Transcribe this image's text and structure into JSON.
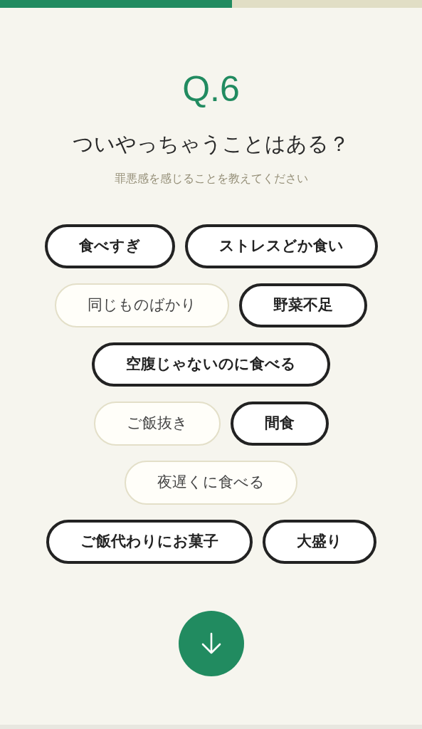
{
  "progress": {
    "level": 0.55
  },
  "question": {
    "number": "Q.6",
    "title": "ついやっちゃうことはある？",
    "subtitle": "罪悪感を感じることを教えてください"
  },
  "options": [
    {
      "label": "食べすぎ",
      "selected": true
    },
    {
      "label": "ストレスどか食い",
      "selected": true
    },
    {
      "label": "同じものばかり",
      "selected": false
    },
    {
      "label": "野菜不足",
      "selected": true
    },
    {
      "label": "空腹じゃないのに食べる",
      "selected": true
    },
    {
      "label": "ご飯抜き",
      "selected": false
    },
    {
      "label": "間食",
      "selected": true
    },
    {
      "label": "夜遅くに食べる",
      "selected": false
    },
    {
      "label": "ご飯代わりにお菓子",
      "selected": true
    },
    {
      "label": "大盛り",
      "selected": true
    }
  ]
}
